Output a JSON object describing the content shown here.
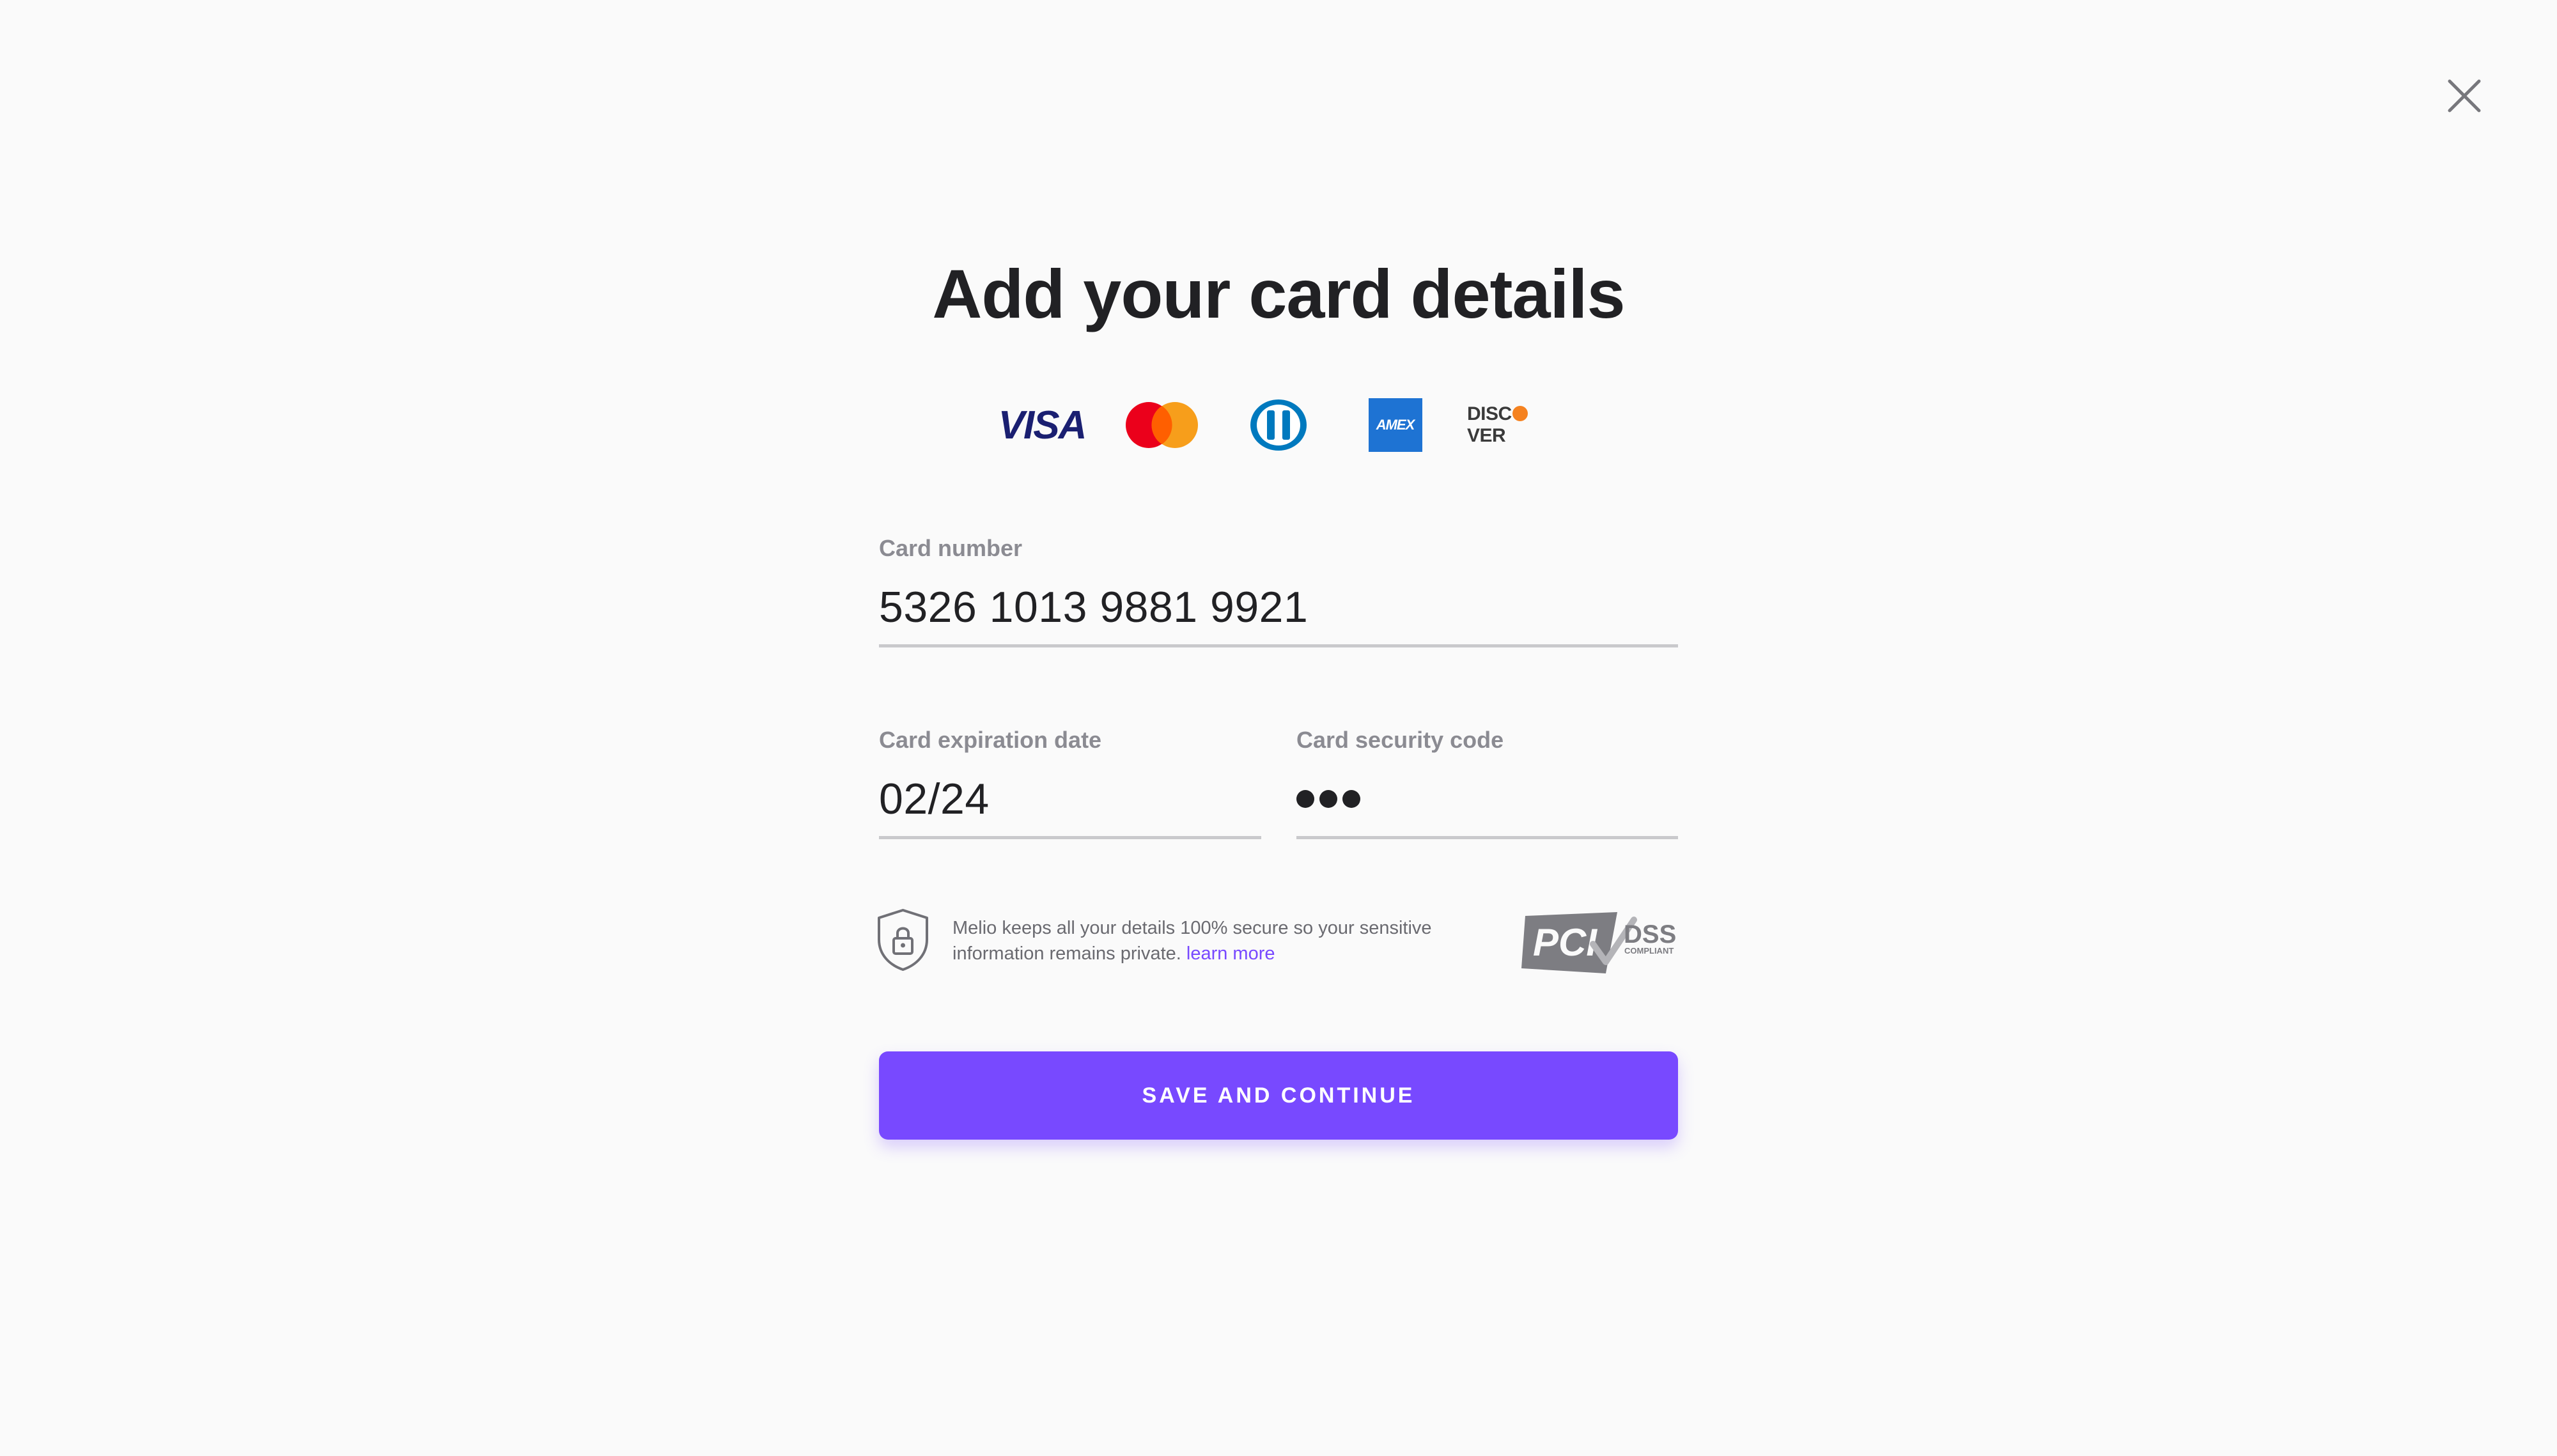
{
  "header": {
    "close_icon": "close-icon"
  },
  "title": "Add your card details",
  "card_brands": {
    "visa": "VISA",
    "mastercard": "mastercard-logo",
    "diners": "diners-club-logo",
    "amex": "AMEX",
    "discover_pre": "DISC",
    "discover_post": "VER"
  },
  "form": {
    "card_number": {
      "label": "Card number",
      "value": "5326 1013 9881 9921"
    },
    "expiration": {
      "label": "Card expiration date",
      "value": "02/24"
    },
    "security_code": {
      "label": "Card security code",
      "masked_length": 3
    }
  },
  "security_notice": {
    "text": "Melio keeps all your details 100% secure so your sensitive information remains private.",
    "link": "learn more",
    "badge_main": "PCI",
    "badge_dss": "DSS",
    "badge_compliant": "COMPLIANT"
  },
  "actions": {
    "save_label": "SAVE AND CONTINUE"
  },
  "colors": {
    "accent": "#7849ff",
    "title": "#212124",
    "label": "#8b8b92",
    "underline": "#c9c9cc",
    "background": "#fafafa"
  }
}
